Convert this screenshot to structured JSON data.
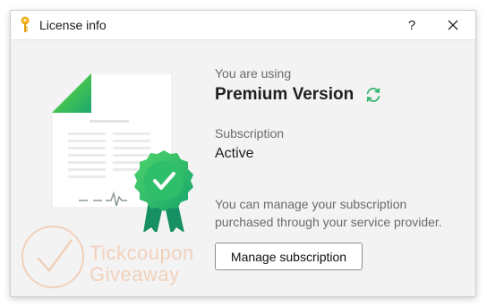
{
  "window": {
    "title": "License info",
    "help_label": "?"
  },
  "license": {
    "using_label": "You are using",
    "version": "Premium Version",
    "subscription_label": "Subscription",
    "subscription_status": "Active",
    "note": "You can manage your subscription purchased through your service provider.",
    "manage_button": "Manage subscription"
  },
  "watermark": {
    "line1": "Tickcoupon",
    "line2": "Giveaway"
  },
  "icons": {
    "app": "key-icon",
    "help": "help-icon",
    "close": "close-icon",
    "refresh": "refresh-icon",
    "certificate": "certificate-icon"
  },
  "colors": {
    "accent_green": "#2fb36a",
    "title_bg": "#ffffff",
    "content_bg": "#f3f3f3",
    "text_muted": "#6b6b6b"
  }
}
